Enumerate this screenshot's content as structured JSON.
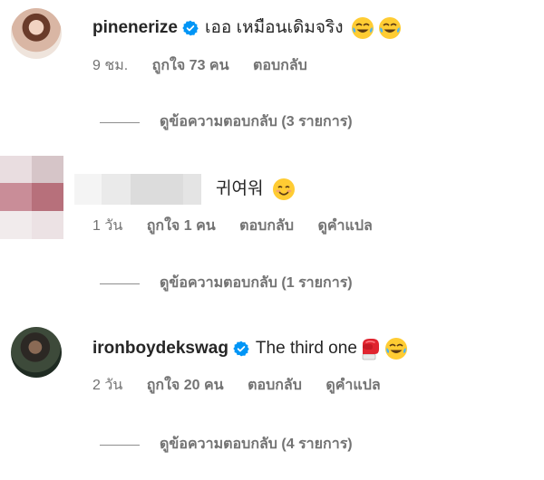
{
  "comments": [
    {
      "username": "pinenerize",
      "verified": true,
      "text": "เออ เหมือนเดิมจริง",
      "emojis": [
        "tears-of-joy",
        "tears-of-joy"
      ],
      "time": "9 ชม.",
      "likes": "ถูกใจ 73 คน",
      "reply": "ตอบกลับ",
      "view_replies": "ดูข้อความตอบกลับ (3 รายการ)"
    },
    {
      "username": "",
      "verified": false,
      "text": "귀여워",
      "emojis": [
        "smiling-face"
      ],
      "time": "1 วัน",
      "likes": "ถูกใจ 1 คน",
      "reply": "ตอบกลับ",
      "translate": "ดูคำแปล",
      "view_replies": "ดูข้อความตอบกลับ (1 รายการ)"
    },
    {
      "username": "ironboydekswag",
      "verified": true,
      "text": "The third one",
      "emojis": [
        "boxing-glove",
        "tears-of-joy"
      ],
      "time": "2 วัน",
      "likes": "ถูกใจ 20 คน",
      "reply": "ตอบกลับ",
      "translate": "ดูคำแปล",
      "view_replies": "ดูข้อความตอบกลับ (4 รายการ)"
    }
  ],
  "colors": {
    "verified_blue": "#0095f6",
    "text": "#262626",
    "muted": "#737373"
  }
}
